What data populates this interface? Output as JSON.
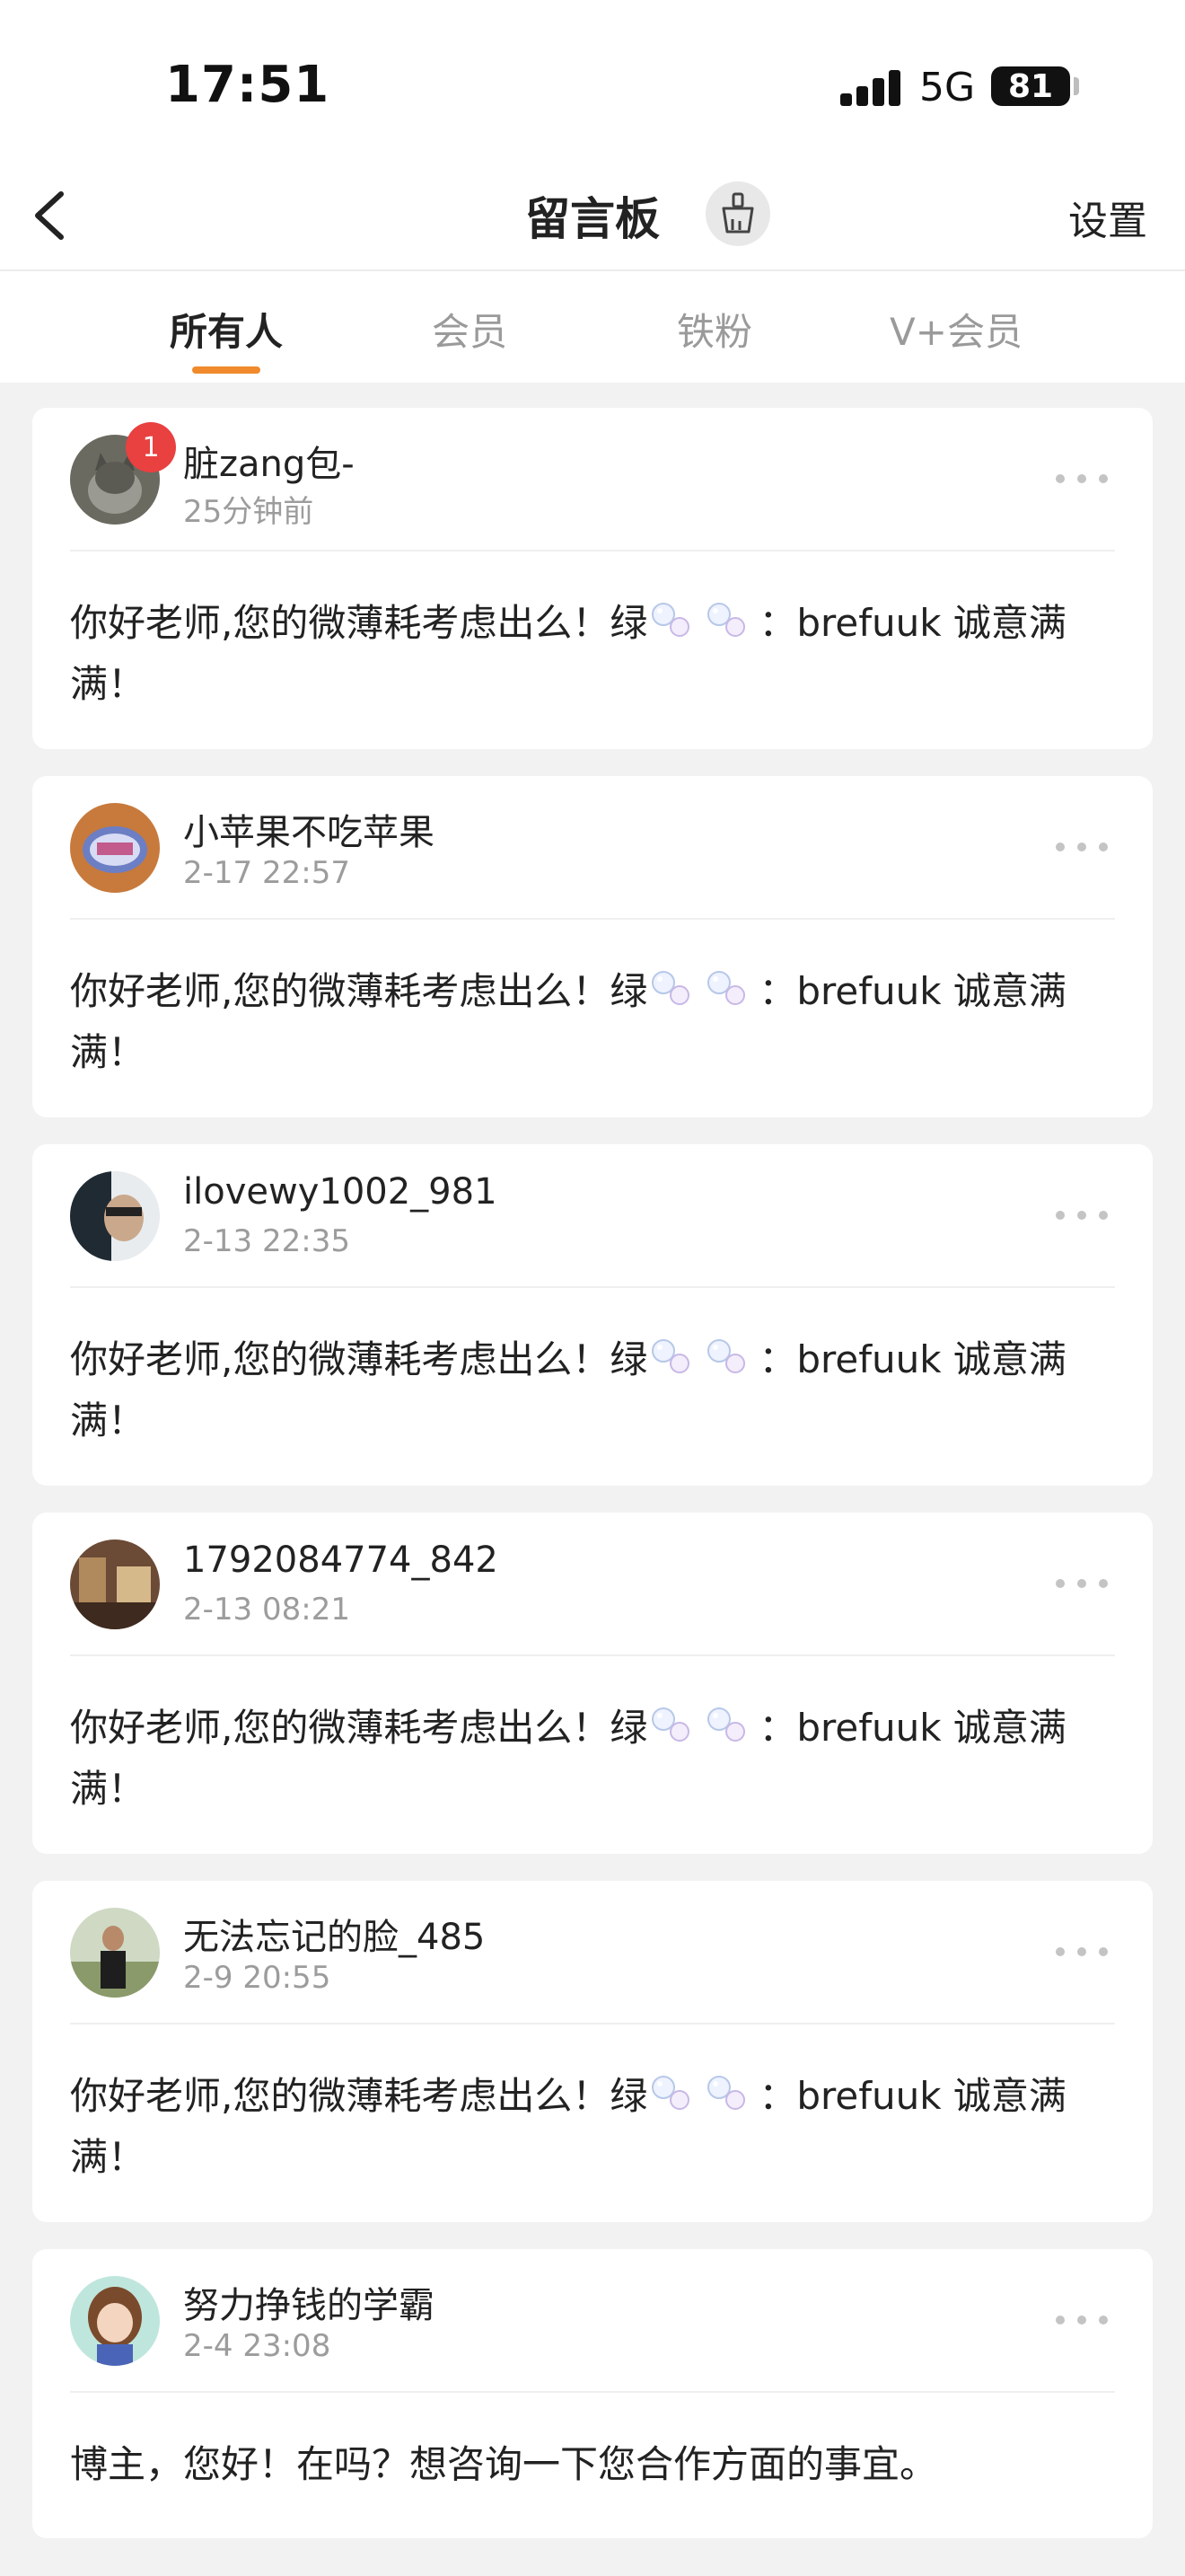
{
  "status_bar": {
    "time": "17:51",
    "network": "5G",
    "battery": "81"
  },
  "nav": {
    "title": "留言板",
    "settings_label": "设置",
    "back_icon": "chevron-left-icon",
    "clean_icon": "broom-icon"
  },
  "tabs": [
    {
      "label": "所有人",
      "active": true
    },
    {
      "label": "会员",
      "active": false
    },
    {
      "label": "铁粉",
      "active": false
    },
    {
      "label": "V+会员",
      "active": false
    }
  ],
  "colors": {
    "accent": "#f08a2c",
    "badge": "#e94040",
    "background": "#f2f2f2"
  },
  "messages": [
    {
      "username": "脏zang包-",
      "time": "25分钟前",
      "badge": "1",
      "text_a": "你好老师,您的微薄耗考虑出么！绿",
      "text_b": "：brefuuk   诚意满满！"
    },
    {
      "username": "小苹果不吃苹果",
      "time": "2-17 22:57",
      "text_a": "你好老师,您的微薄耗考虑出么！绿",
      "text_b": "：brefuuk   诚意满满！"
    },
    {
      "username": "ilovewy1002_981",
      "time": "2-13 22:35",
      "text_a": "你好老师,您的微薄耗考虑出么！绿",
      "text_b": "：brefuuk   诚意满满！"
    },
    {
      "username": "1792084774_842",
      "time": "2-13 08:21",
      "text_a": "你好老师,您的微薄耗考虑出么！绿",
      "text_b": "：brefuuk   诚意满满！"
    },
    {
      "username": "无法忘记的脸_485",
      "time": "2-9 20:55",
      "text_a": "你好老师,您的微薄耗考虑出么！绿",
      "text_b": "：brefuuk   诚意满满！"
    },
    {
      "username": "努力挣钱的学霸",
      "time": "2-4 23:08",
      "text_a": "博主，您好！在吗？想咨询一下您合作方面的事宜。",
      "text_b": ""
    }
  ]
}
